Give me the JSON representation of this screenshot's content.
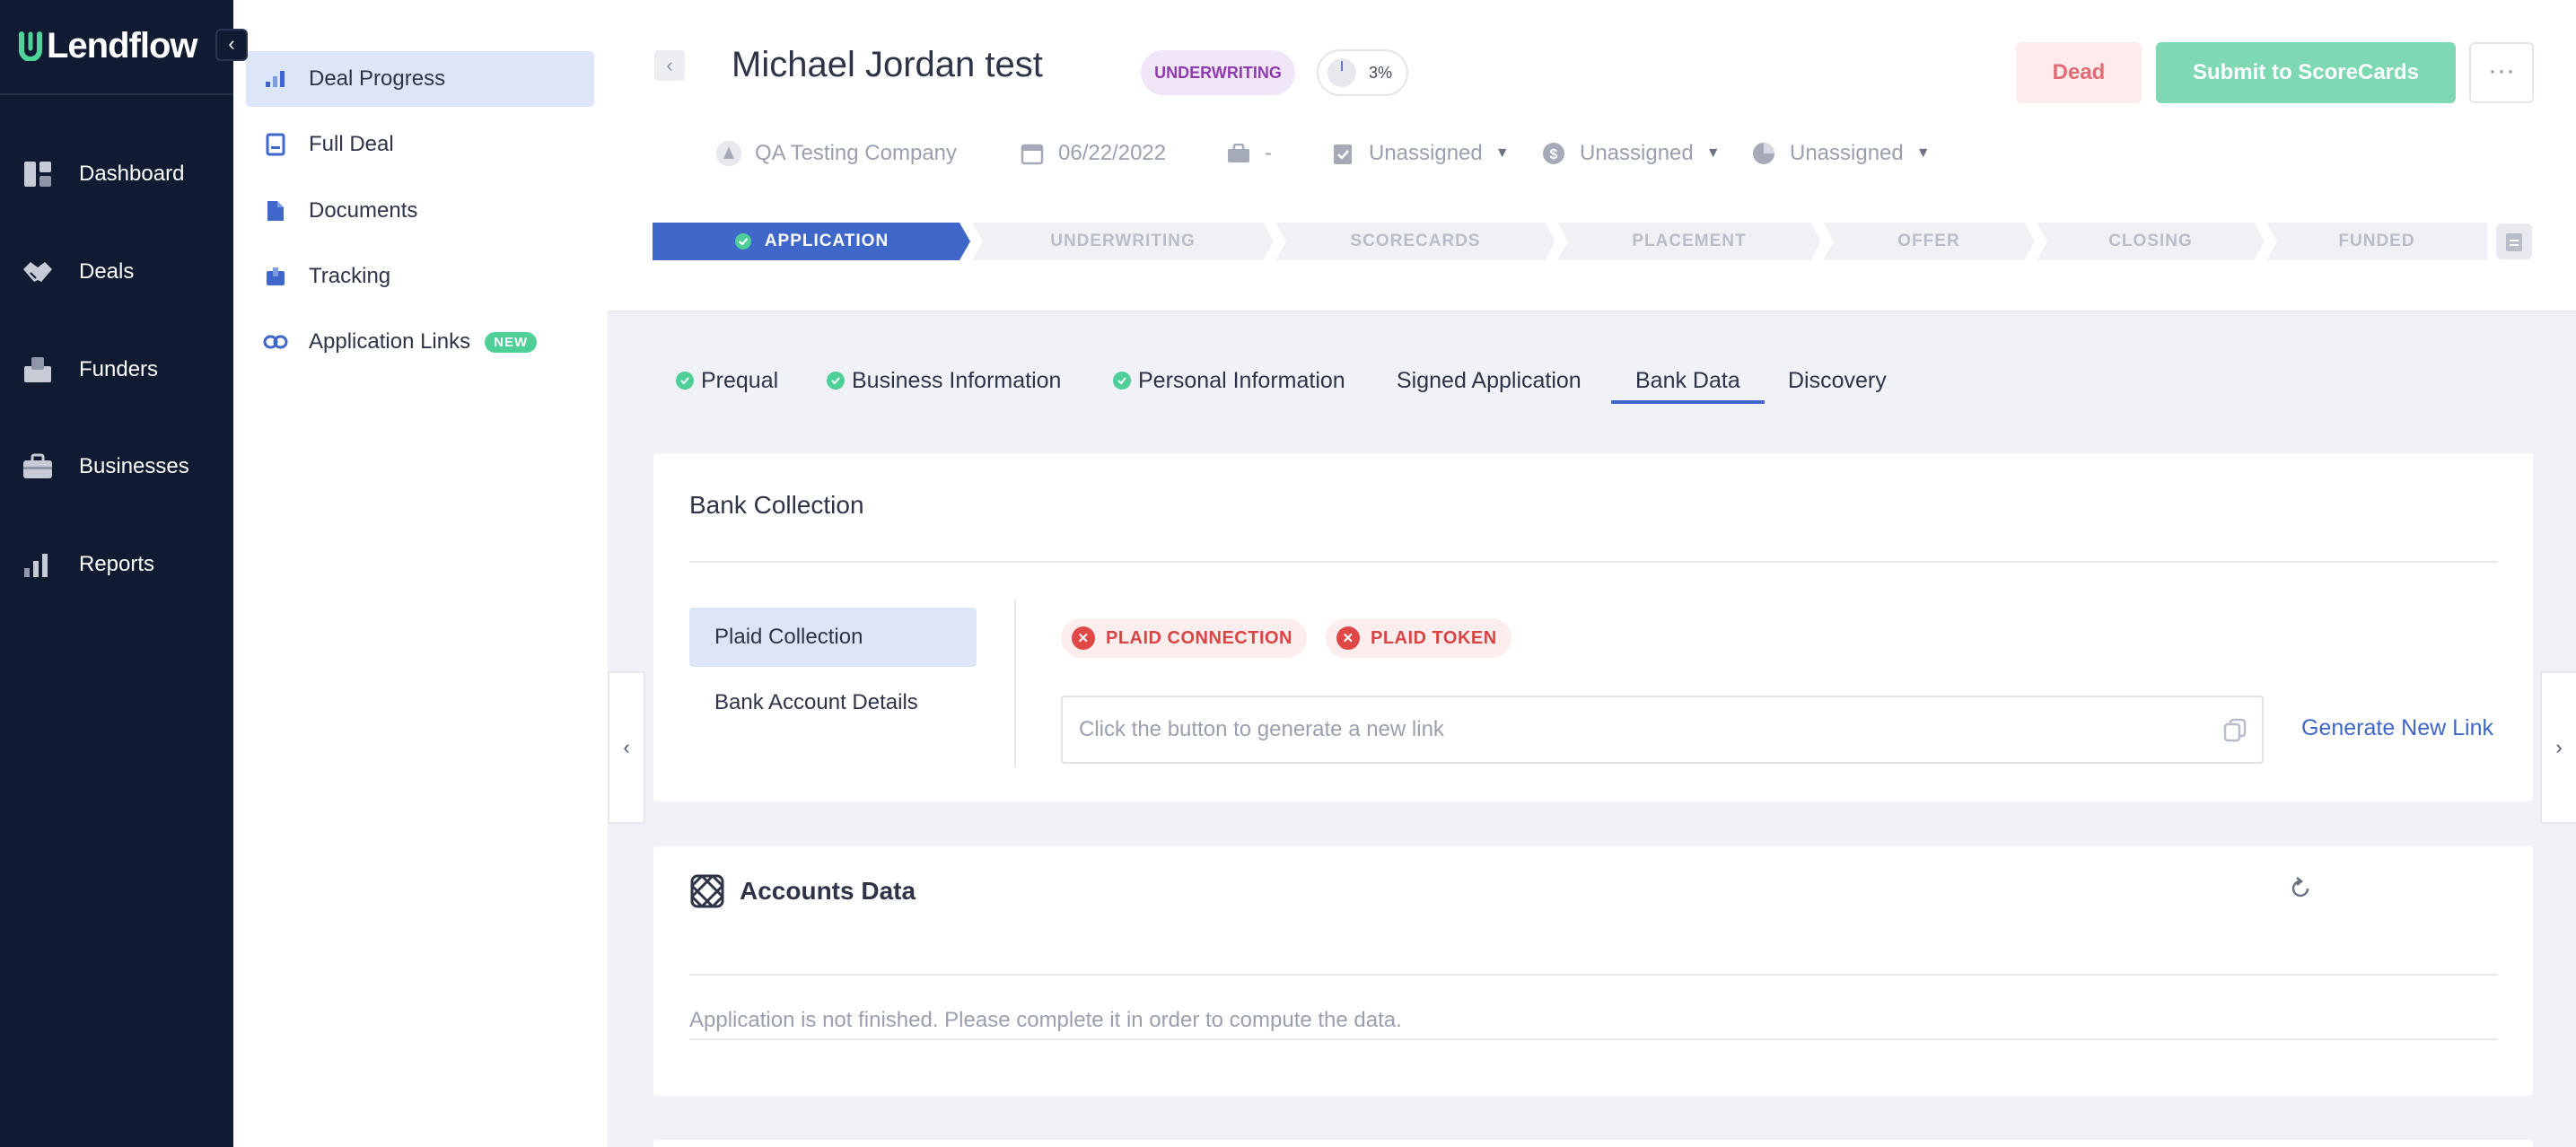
{
  "brand": {
    "name": "Lendflow",
    "accent": "#4fd39b",
    "nav_bg": "#101b31",
    "primary": "#3f67c9"
  },
  "nav": {
    "items": [
      {
        "label": "Dashboard",
        "icon": "dashboard-icon"
      },
      {
        "label": "Deals",
        "icon": "handshake-icon"
      },
      {
        "label": "Funders",
        "icon": "funders-icon"
      },
      {
        "label": "Businesses",
        "icon": "briefcase-icon"
      },
      {
        "label": "Reports",
        "icon": "reports-icon"
      }
    ]
  },
  "subnav": {
    "items": [
      {
        "label": "Deal Progress",
        "icon": "bar-chart-icon",
        "active": true
      },
      {
        "label": "Full Deal",
        "icon": "document-icon"
      },
      {
        "label": "Documents",
        "icon": "file-icon"
      },
      {
        "label": "Tracking",
        "icon": "inbox-icon"
      },
      {
        "label": "Application Links",
        "icon": "link-icon",
        "badge": "NEW"
      }
    ]
  },
  "header": {
    "title": "Michael Jordan test",
    "stage_badge": "UNDERWRITING",
    "progress_pct": "3%",
    "dead_label": "Dead",
    "submit_label": "Submit to ScoreCards",
    "more_label": "···",
    "meta": {
      "company": "QA Testing Company",
      "date": "06/22/2022",
      "industry": "-",
      "assignee_1": "Unassigned",
      "assignee_2": "Unassigned",
      "assignee_3": "Unassigned"
    }
  },
  "stepper": {
    "steps": [
      "APPLICATION",
      "UNDERWRITING",
      "SCORECARDS",
      "PLACEMENT",
      "OFFER",
      "CLOSING",
      "FUNDED"
    ],
    "active_index": 0
  },
  "tabs": [
    {
      "label": "Prequal",
      "complete": true
    },
    {
      "label": "Business Information",
      "complete": true
    },
    {
      "label": "Personal Information",
      "complete": true
    },
    {
      "label": "Signed Application",
      "complete": false
    },
    {
      "label": "Bank Data",
      "complete": false,
      "active": true
    },
    {
      "label": "Discovery",
      "complete": false
    }
  ],
  "bank_collection": {
    "title": "Bank Collection",
    "menu": [
      "Plaid Collection",
      "Bank Account Details"
    ],
    "status_chips": [
      "PLAID CONNECTION",
      "PLAID TOKEN"
    ],
    "link_placeholder": "Click the button to generate a new link",
    "generate_label": "Generate New Link"
  },
  "accounts_data": {
    "title": "Accounts Data",
    "message": "Application is not finished. Please complete it in order to compute the data."
  }
}
